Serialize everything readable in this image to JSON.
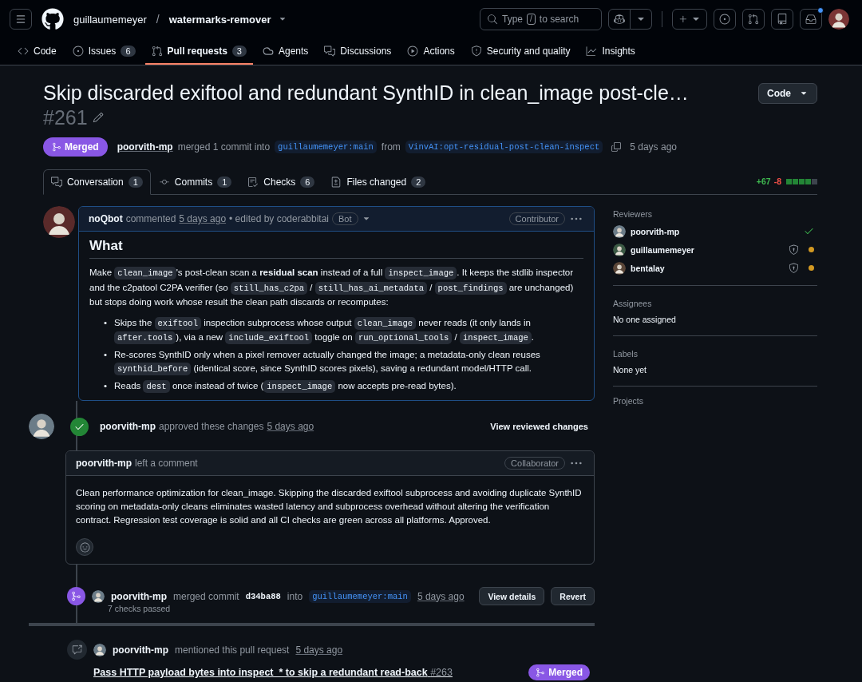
{
  "header": {
    "owner": "guillaumemeyer",
    "separator": "/",
    "repo": "watermarks-remover",
    "search": {
      "hint_start": "Type",
      "key": "/",
      "hint_end": "to search"
    },
    "inbox_unread": true
  },
  "nav_tabs": [
    {
      "label": "Code",
      "selected": false
    },
    {
      "label": "Issues",
      "count": "6",
      "selected": false
    },
    {
      "label": "Pull requests",
      "count": "3",
      "selected": true
    },
    {
      "label": "Agents",
      "selected": false
    },
    {
      "label": "Discussions",
      "selected": false
    },
    {
      "label": "Actions",
      "selected": false
    },
    {
      "label": "Security and quality",
      "selected": false
    },
    {
      "label": "Insights",
      "selected": false
    }
  ],
  "pr": {
    "title": "Skip discarded exiftool and redundant SynthID in clean_image post-cle…",
    "number": "#261",
    "code_button": "Code",
    "state": "Merged",
    "author": "poorvith-mp",
    "action": "merged 1 commit into",
    "base": "guillaumemeyer:main",
    "from": "from",
    "head": "VinvAI:opt-residual-post-clean-inspect",
    "time": "5 days ago"
  },
  "pr_tabs": [
    {
      "label": "Conversation",
      "count": "1",
      "selected": true
    },
    {
      "label": "Commits",
      "count": "1",
      "selected": false
    },
    {
      "label": "Checks",
      "count": "6",
      "selected": false
    },
    {
      "label": "Files changed",
      "count": "2",
      "selected": false
    }
  ],
  "diffstat": {
    "additions": "+67",
    "deletions": "-8",
    "blocks": [
      {
        "kind": "added"
      },
      {
        "kind": "added"
      },
      {
        "kind": "added"
      },
      {
        "kind": "added"
      },
      {
        "kind": "neutral"
      }
    ]
  },
  "timeline": [
    {
      "kind": "comment",
      "author": "noQbot",
      "action": "commented",
      "time": "5 days ago",
      "edited": "• edited by coderabbitai",
      "bot_badge": "Bot",
      "role": "Contributor",
      "heading": "What",
      "paragraph": [
        {
          "kind": "text",
          "text": "Make "
        },
        {
          "kind": "code",
          "text": "clean_image"
        },
        {
          "kind": "text",
          "text": "'s post-clean scan a "
        },
        {
          "kind": "bold",
          "text": "residual scan"
        },
        {
          "kind": "text",
          "text": " instead of a full "
        },
        {
          "kind": "code",
          "text": "inspect_image"
        },
        {
          "kind": "text",
          "text": ". It keeps the stdlib inspector and the c2patool C2PA verifier (so "
        },
        {
          "kind": "code",
          "text": "still_has_c2pa"
        },
        {
          "kind": "text",
          "text": " / "
        },
        {
          "kind": "code",
          "text": "still_has_ai_metadata"
        },
        {
          "kind": "text",
          "text": " / "
        },
        {
          "kind": "code",
          "text": "post_findings"
        },
        {
          "kind": "text",
          "text": " are unchanged) but stops doing work whose result the clean path discards or recomputes:"
        }
      ],
      "bullets": [
        {
          "marker": "•",
          "segments": [
            {
              "kind": "text",
              "text": "Skips the "
            },
            {
              "kind": "code",
              "text": "exiftool"
            },
            {
              "kind": "text",
              "text": " inspection subprocess whose output "
            },
            {
              "kind": "code",
              "text": "clean_image"
            },
            {
              "kind": "text",
              "text": " never reads (it only lands in "
            },
            {
              "kind": "code",
              "text": "after.tools"
            },
            {
              "kind": "text",
              "text": "), via a new "
            },
            {
              "kind": "code",
              "text": "include_exiftool"
            },
            {
              "kind": "text",
              "text": " toggle on "
            },
            {
              "kind": "code",
              "text": "run_optional_tools"
            },
            {
              "kind": "text",
              "text": " / "
            },
            {
              "kind": "code",
              "text": "inspect_image"
            },
            {
              "kind": "text",
              "text": "."
            }
          ]
        },
        {
          "marker": "•",
          "segments": [
            {
              "kind": "text",
              "text": "Re-scores SynthID only when a pixel remover actually changed the image; a metadata-only clean reuses "
            },
            {
              "kind": "code",
              "text": "synthid_before"
            },
            {
              "kind": "text",
              "text": " (identical score, since SynthID scores pixels), saving a redundant model/HTTP call."
            }
          ]
        },
        {
          "marker": "•",
          "segments": [
            {
              "kind": "text",
              "text": "Reads "
            },
            {
              "kind": "code",
              "text": "dest"
            },
            {
              "kind": "text",
              "text": " once instead of twice ("
            },
            {
              "kind": "code",
              "text": "inspect_image"
            },
            {
              "kind": "text",
              "text": " now accepts pre-read bytes)."
            }
          ]
        }
      ]
    },
    {
      "kind": "review",
      "author": "poorvith-mp",
      "action": "approved these changes",
      "time": "5 days ago",
      "link": "View reviewed changes",
      "comment": {
        "author": "poorvith-mp",
        "action": "left a comment",
        "role": "Collaborator",
        "body": "Clean performance optimization for clean_image. Skipping the discarded exiftool subprocess and avoiding duplicate SynthID scoring on metadata-only cleans eliminates wasted latency and subprocess overhead without altering the verification contract. Regression test coverage is solid and all CI checks are green across all platforms. Approved."
      }
    },
    {
      "kind": "merge",
      "author": "poorvith-mp",
      "action": "merged commit",
      "commit": "d34ba88",
      "into": "into",
      "branch": "guillaumemeyer:main",
      "time": "5 days ago",
      "subtext": "7 checks passed",
      "buttons": [
        "View details",
        "Revert"
      ]
    },
    {
      "kind": "mention",
      "author": "poorvith-mp",
      "action": "mentioned this pull request",
      "time": "5 days ago",
      "link_title": "Pass HTTP payload bytes into inspect_* to skip a redundant read-back",
      "link_number": "#263",
      "badge": "Merged"
    }
  ],
  "sidebar": {
    "reviewers": {
      "heading": "Reviewers",
      "items": [
        {
          "name": "poorvith-mp",
          "kind": "approved"
        },
        {
          "name": "guillaumemeyer",
          "kind": "pending"
        },
        {
          "name": "bentalay",
          "kind": "pending"
        }
      ]
    },
    "assignees": {
      "heading": "Assignees",
      "value": "No one assigned"
    },
    "labels": {
      "heading": "Labels",
      "value": "None yet"
    },
    "projects": {
      "heading": "Projects"
    }
  }
}
